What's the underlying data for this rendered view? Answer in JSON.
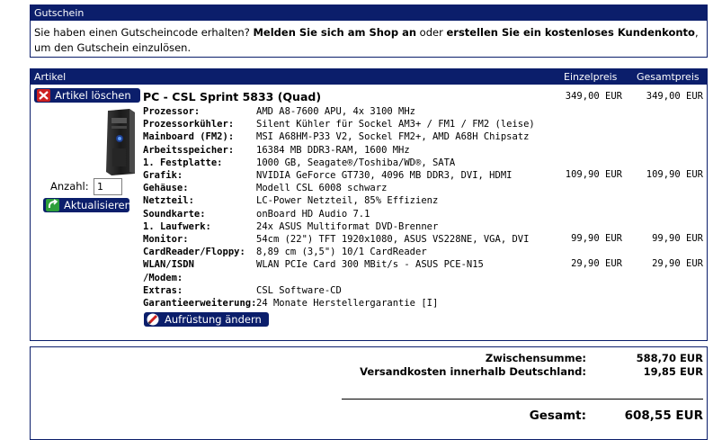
{
  "voucher": {
    "header": "Gutschein",
    "text_1": "Sie haben einen Gutscheincode erhalten? ",
    "login_link": "Melden Sie sich am Shop an",
    "text_2": " oder ",
    "register_link": "erstellen Sie ein kostenloses Kundenkonto",
    "text_3": ", um den Gutschein einzulösen."
  },
  "cart": {
    "col_article": "Artikel",
    "col_unit_price": "Einzelpreis",
    "col_total_price": "Gesamtpreis",
    "delete_button": "Artikel löschen",
    "quantity_label": "Anzahl:",
    "quantity_value": "1",
    "update_button": "Aktualisieren",
    "product_title": "PC - CSL Sprint 5833 (Quad)",
    "product_unit_price": "349,00 EUR",
    "product_total_price": "349,00 EUR",
    "upgrade_button": "Aufrüstung ändern",
    "specs": [
      {
        "label": "Prozessor:",
        "value": "AMD A8-7600 APU, 4x 3100 MHz",
        "unit": "",
        "total": ""
      },
      {
        "label": "Prozessorkühler:",
        "value": "Silent Kühler für Sockel AM3+ / FM1 / FM2 (leise)",
        "unit": "",
        "total": ""
      },
      {
        "label": "Mainboard (FM2):",
        "value": "MSI A68HM-P33 V2, Sockel FM2+, AMD A68H Chipsatz",
        "unit": "",
        "total": ""
      },
      {
        "label": "Arbeitsspeicher:",
        "value": "16384 MB DDR3-RAM, 1600 MHz",
        "unit": "",
        "total": ""
      },
      {
        "label": "1. Festplatte:",
        "value": "1000 GB, Seagate®/Toshiba/WD®, SATA",
        "unit": "",
        "total": ""
      },
      {
        "label": "Grafik:",
        "value": "NVIDIA GeForce GT730, 4096 MB DDR3, DVI, HDMI",
        "unit": "109,90 EUR",
        "total": "109,90 EUR"
      },
      {
        "label": "Gehäuse:",
        "value": "Modell CSL 6008 schwarz",
        "unit": "",
        "total": ""
      },
      {
        "label": "Netzteil:",
        "value": "LC-Power Netzteil, 85% Effizienz",
        "unit": "",
        "total": ""
      },
      {
        "label": "Soundkarte:",
        "value": "onBoard HD Audio 7.1",
        "unit": "",
        "total": ""
      },
      {
        "label": "1. Laufwerk:",
        "value": "24x ASUS Multiformat DVD-Brenner",
        "unit": "",
        "total": ""
      },
      {
        "label": "Monitor:",
        "value": "54cm (22\") TFT 1920x1080, ASUS VS228NE, VGA, DVI",
        "unit": "99,90 EUR",
        "total": "99,90 EUR"
      },
      {
        "label": "CardReader/Floppy:",
        "value": "8,89 cm (3,5\") 10/1 CardReader",
        "unit": "",
        "total": ""
      },
      {
        "label": "WLAN/ISDN",
        "value": "WLAN PCIe Card 300 MBit/s - ASUS PCE-N15",
        "unit": "29,90 EUR",
        "total": "29,90 EUR"
      },
      {
        "label": "/Modem:",
        "value": "",
        "unit": "",
        "total": ""
      },
      {
        "label": "Extras:",
        "value": "CSL Software-CD",
        "unit": "",
        "total": ""
      },
      {
        "label": "Garantieerweiterung:",
        "value": "24 Monate Herstellergarantie [I]",
        "unit": "",
        "total": ""
      }
    ]
  },
  "summary": {
    "subtotal_label": "Zwischensumme:",
    "subtotal_value": "588,70 EUR",
    "shipping_label": "Versandkosten innerhalb Deutschland:",
    "shipping_value": "19,85 EUR",
    "total_label": "Gesamt:",
    "total_value": "608,55 EUR"
  },
  "colors": {
    "header_bg": "#0b1e6b",
    "text": "#000000",
    "icon_red": "#cc2020",
    "icon_green": "#2e9e3a"
  }
}
